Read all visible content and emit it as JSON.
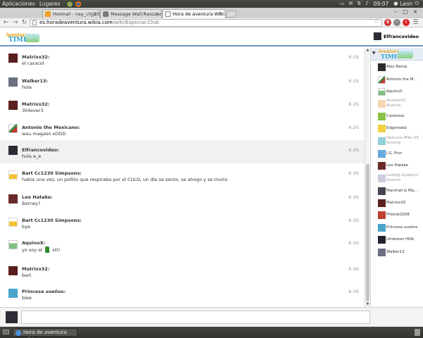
{
  "os_panel": {
    "menus": [
      "Aplicaciones",
      "Lugares"
    ],
    "clock": "09:07",
    "user": "Leon"
  },
  "tabs": [
    {
      "title": "Hotmail - nay_chjj20@hot",
      "fav_color": "#f0a020",
      "active": false
    },
    {
      "title": "Message Wall:Raxzzor - Ho",
      "fav_color": "#7a7a7a",
      "active": false
    },
    {
      "title": "Hora de aventura Wiki: Ch",
      "fav_color": "#f8f8f8",
      "active": true
    }
  ],
  "toolbar": {
    "url_host": "es.horadeaventura.wikia.com",
    "url_path": "/wiki/Especial:Chat"
  },
  "header": {
    "logo_top": "Aventura",
    "logo_bottom": "TIME",
    "current_user": "Elfrancovideo"
  },
  "messages": [
    {
      "user": "Matrixx32:",
      "text": "el caracol",
      "time": "6:26",
      "avatar_color": "#5a1f1f",
      "highlight": false
    },
    {
      "user": "Walker13:",
      "text": "hola",
      "time": "6:26",
      "avatar_color": "#6a7080",
      "highlight": false
    },
    {
      "user": "Matrixx32:",
      "text": "3li4ever3",
      "time": "6:26",
      "avatar_color": "#5a1f1f",
      "highlight": false
    },
    {
      "user": "Antonio the Mexicano:",
      "text": "wau magaso xDDD",
      "time": "6:26",
      "avatar_color": "#3a8a3a",
      "highlight": false
    },
    {
      "user": "Elfrancovideo:",
      "text": "hola e_e",
      "time": "6:26",
      "avatar_color": "#2d2b33",
      "highlight": true
    },
    {
      "user": "Bart Cc1230 Simpsons:",
      "text": "habia una vez, un pollito que respiraba por el CULO, un dia se sento, se ahogo y se murio",
      "time": "6:26",
      "avatar_color": "#f2c230",
      "highlight": false
    },
    {
      "user": "Leo Hatake:",
      "text": "Barney?",
      "time": "6:26",
      "avatar_color": "#6b2a2a",
      "highlight": false
    },
    {
      "user": "Bart Cc1230 Simpsons:",
      "text": "bye",
      "time": "6:26",
      "avatar_color": "#f2c230",
      "highlight": false
    },
    {
      "user": "AquinoX:",
      "text_before": "yo soy el",
      "text_after": "xD!",
      "time": "6:26",
      "avatar_color": "#7fbf7f",
      "highlight": false,
      "inline_icon": "green-hat-icon"
    },
    {
      "user": "Matrixx32:",
      "text": "bart",
      "time": "6:26",
      "avatar_color": "#5a1f1f",
      "highlight": false
    },
    {
      "user": "Princesa sueños:",
      "text": "biee",
      "time": "6:26",
      "avatar_color": "#4aa3c8",
      "highlight": false
    }
  ],
  "userlist": [
    {
      "name": "Alex Rama",
      "avatar_color": "#2a2a2a",
      "away": false
    },
    {
      "name": "Antonio the M...",
      "avatar_color": "#3a8a3a",
      "away": false
    },
    {
      "name": "AquinoX",
      "avatar_color": "#7fbf7f",
      "away": false
    },
    {
      "name": "Ariellox07",
      "status": "Ausente",
      "avatar_color": "#f0c080",
      "away": true
    },
    {
      "name": "Cateloise",
      "avatar_color": "#8bc34a",
      "away": false
    },
    {
      "name": "Edgerballz",
      "avatar_color": "#f2d040",
      "away": false
    },
    {
      "name": "Hatsune Miku 05",
      "status": "Ausente",
      "avatar_color": "#4ab0c0",
      "away": true
    },
    {
      "name": "J.G. Finn",
      "avatar_color": "#66aadd",
      "away": false
    },
    {
      "name": "Leo Hatake",
      "avatar_color": "#6b2a2a",
      "away": false
    },
    {
      "name": "Ludwig Llywelyn",
      "status": "Ausente",
      "avatar_color": "#aaaacc",
      "away": true
    },
    {
      "name": "Marshall & Ma...",
      "avatar_color": "#444455",
      "away": false
    },
    {
      "name": "Matrixx32",
      "avatar_color": "#5a1f1f",
      "away": false
    },
    {
      "name": "Photok2008",
      "avatar_color": "#c04030",
      "away": false
    },
    {
      "name": "Princesa sueños",
      "avatar_color": "#4aa3c8",
      "away": false
    },
    {
      "name": "Umbreon HDA",
      "avatar_color": "#222233",
      "away": false
    },
    {
      "name": "Walker13",
      "avatar_color": "#6a7080",
      "away": false
    }
  ],
  "taskbar": {
    "window_title": "Hora de aventura Wiki..."
  }
}
